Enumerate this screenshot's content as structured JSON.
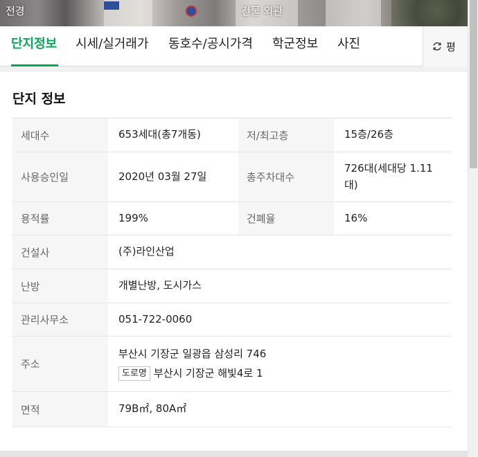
{
  "photos": {
    "left_label": "전경",
    "center_label": "건물 외관"
  },
  "tabs": [
    {
      "label": "단지정보",
      "active": true
    },
    {
      "label": "시세/실거래가",
      "active": false
    },
    {
      "label": "동호수/공시가격",
      "active": false
    },
    {
      "label": "학군정보",
      "active": false
    },
    {
      "label": "사진",
      "active": false
    }
  ],
  "refresh": {
    "label": "평",
    "icon": "refresh-icon"
  },
  "section": {
    "title": "단지 정보"
  },
  "info": {
    "households_label": "세대수",
    "households": "653세대(총7개동)",
    "floors_label": "저/최고층",
    "floors": "15층/26층",
    "approval_label": "사용승인일",
    "approval": "2020년 03월 27일",
    "parking_label": "총주차대수",
    "parking": "726대(세대당 1.11대)",
    "far_label": "용적률",
    "far": "199%",
    "bcr_label": "건폐율",
    "bcr": "16%",
    "builder_label": "건설사",
    "builder": "(주)라인산업",
    "heating_label": "난방",
    "heating": "개별난방, 도시가스",
    "office_label": "관리사무소",
    "office": "051-722-0060",
    "address_label": "주소",
    "address": "부산시 기장군 일광읍 삼성리 746",
    "road_badge": "도로명",
    "road_address": "부산시 기장군 해빛4로 1",
    "area_label": "면적",
    "area": "79B㎡, 80A㎡"
  },
  "colors": {
    "accent": "#03aa5a",
    "header_bg": "#f6f6f6"
  }
}
